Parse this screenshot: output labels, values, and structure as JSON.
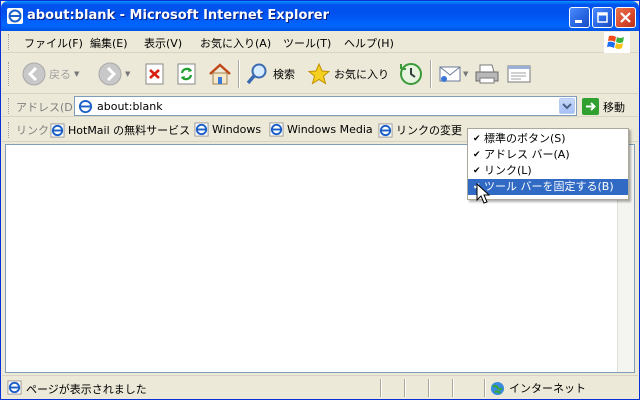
{
  "window": {
    "title": "about:blank - Microsoft Internet Explorer"
  },
  "menubar": {
    "items": [
      "ファイル(F)",
      "編集(E)",
      "表示(V)",
      "お気に入り(A)",
      "ツール(T)",
      "ヘルプ(H)"
    ]
  },
  "toolbar": {
    "back_label": "戻る",
    "search_label": "検索",
    "favorites_label": "お気に入り"
  },
  "address": {
    "label": "アドレス(D)",
    "value": "about:blank",
    "go_label": "移動"
  },
  "links": {
    "label": "リンク",
    "items": [
      "HotMail の無料サービス",
      "Windows",
      "Windows Media",
      "リンクの変更"
    ]
  },
  "context_menu": {
    "items": [
      {
        "label": "標準のボタン(S)",
        "checked": true
      },
      {
        "label": "アドレス バー(A)",
        "checked": true
      },
      {
        "label": "リンク(L)",
        "checked": true
      },
      {
        "label": "ツール バーを固定する(B)",
        "checked": true
      }
    ],
    "highlight_color": "#316ac5"
  },
  "status": {
    "text": "ページが表示されました",
    "zone": "インターネット"
  },
  "colors": {
    "titlebar": "#0053ee",
    "chrome": "#ece9d8"
  }
}
